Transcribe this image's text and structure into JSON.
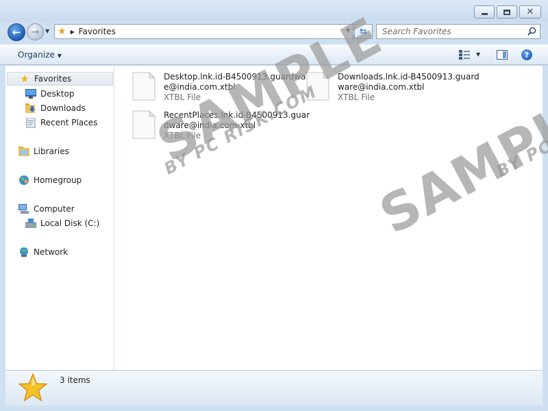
{
  "address": {
    "location": "Favorites"
  },
  "search": {
    "placeholder": "Search Favorites"
  },
  "toolbar": {
    "organize_label": "Organize"
  },
  "sidebar": {
    "favorites": "Favorites",
    "desktop": "Desktop",
    "downloads": "Downloads",
    "recent_places": "Recent Places",
    "libraries": "Libraries",
    "homegroup": "Homegroup",
    "computer": "Computer",
    "local_disk": "Local Disk (C:)",
    "network": "Network"
  },
  "files": [
    {
      "name_line1": "Desktop.lnk.id-B4500913.guardwar",
      "name_line2": "e@india.com.xtbl",
      "type": "XTBL File"
    },
    {
      "name_line1": "Downloads.lnk.id-B4500913.guard",
      "name_line2": "ware@india.com.xtbl",
      "type": "XTBL File"
    },
    {
      "name_line1": "RecentPlaces.lnk.id-B4500913.guar",
      "name_line2": "dware@india.com.xtbl",
      "type": "XTBL File"
    }
  ],
  "status": {
    "count_text": "3 items"
  },
  "watermark": {
    "main": "SAMPLE",
    "sub": "BY PC RISK.COM"
  },
  "colors": {
    "window_frame": "#cfe0f1",
    "accent_blue": "#1d5fb8",
    "star_gold": "#f2b51c"
  }
}
